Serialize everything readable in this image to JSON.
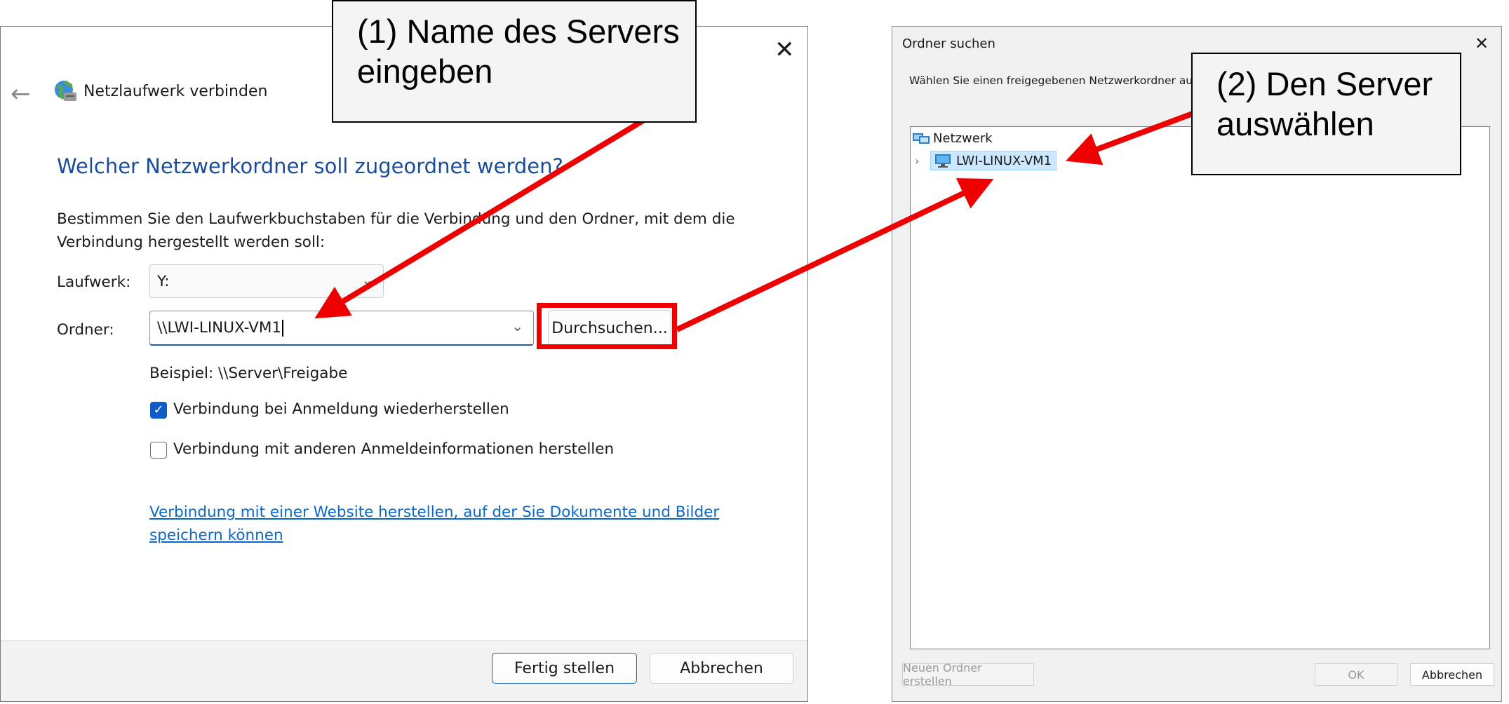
{
  "left_dialog": {
    "title": "Netzlaufwerk verbinden",
    "close_symbol": "✕",
    "back_symbol": "←",
    "heading": "Welcher Netzwerkordner soll zugeordnet werden?",
    "description": "Bestimmen Sie den Laufwerkbuchstaben für die Verbindung und den Ordner, mit dem die Verbindung hergestellt werden soll:",
    "drive_label": "Laufwerk:",
    "drive_value": "Y:",
    "folder_label": "Ordner:",
    "folder_value": "\\\\LWI-LINUX-VM1",
    "browse_label": "Durchsuchen...",
    "example": "Beispiel: \\\\Server\\Freigabe",
    "reconnect_label": "Verbindung bei Anmeldung wiederherstellen",
    "reconnect_checked": true,
    "other_credentials_label": "Verbindung mit anderen Anmeldeinformationen herstellen",
    "other_credentials_checked": false,
    "website_link": "Verbindung mit einer Website herstellen, auf der Sie Dokumente und Bilder speichern können",
    "finish_label": "Fertig stellen",
    "cancel_label": "Abbrechen"
  },
  "right_dialog": {
    "title": "Ordner suchen",
    "close_symbol": "✕",
    "description": "Wählen Sie einen freigegebenen Netzwerkordner aus",
    "tree_root": "Netzwerk",
    "tree_item": "LWI-LINUX-VM1",
    "new_folder_label": "Neuen Ordner erstellen",
    "ok_label": "OK",
    "cancel_label": "Abbrechen"
  },
  "callouts": {
    "step1": "(1) Name des Servers eingeben",
    "step2": "(2) Den Server auswählen"
  },
  "colors": {
    "annotation_red": "#ee0000",
    "heading_blue": "#1a4c9c",
    "link_blue": "#0b68c8",
    "checkbox_blue": "#0f5cc7",
    "selection_bg": "#cce8ff"
  }
}
